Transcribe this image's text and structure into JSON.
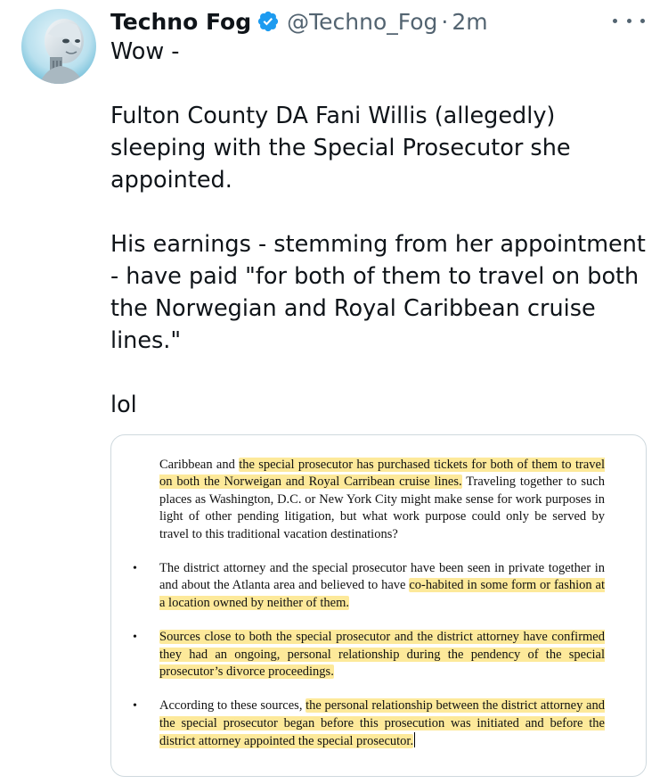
{
  "author": {
    "name": "Techno Fog",
    "handle": "@Techno_Fog",
    "separator": "·",
    "time": "2m"
  },
  "tweet": {
    "paragraphs": [
      "Wow -",
      "Fulton County DA Fani Willis (allegedly) sleeping with the Special Prosecutor she appointed.",
      "His earnings - stemming from her appointment - have paid \"for both of them to travel on both the Norwegian and Royal Caribbean cruise lines.\"",
      "lol"
    ]
  },
  "document": {
    "intro": {
      "plain_1": "Caribbean and ",
      "highlight_1": "the special prosecutor has purchased tickets for both of them to travel on both the Norweigan and Royal Carribean cruise lines.",
      "plain_2": " Traveling together to such places as Washington, D.C. or New York City might make sense for work purposes in light of other pending litigation, but what work purpose could only be served by travel to this traditional vacation destinations?"
    },
    "bullets": [
      {
        "plain_1": "The district attorney and the special prosecutor have been seen in private together in and about the Atlanta area and believed to have ",
        "highlight": "co-habited in some form or fashion at a location owned by neither of them.",
        "plain_2": ""
      },
      {
        "plain_1": "",
        "highlight": "Sources close to both the special prosecutor and the district attorney have confirmed they had an ongoing, personal relationship during the pendency of the special prosecutor’s divorce proceedings.",
        "plain_2": ""
      },
      {
        "plain_1": "According to these sources, ",
        "highlight": "the personal relationship between the district attorney and the special prosecutor began before this prosecution was initiated and before the district attorney appointed the special prosecutor.",
        "plain_2": ""
      }
    ],
    "bullet_glyph": "•"
  },
  "colors": {
    "text": "#0f1419",
    "secondary": "#536471",
    "verified": "#1d9bf0",
    "highlight": "#fde99a",
    "border": "#cfd9de"
  },
  "icons": {
    "verified": "verified-badge-icon",
    "more": "more-horizontal-icon"
  }
}
